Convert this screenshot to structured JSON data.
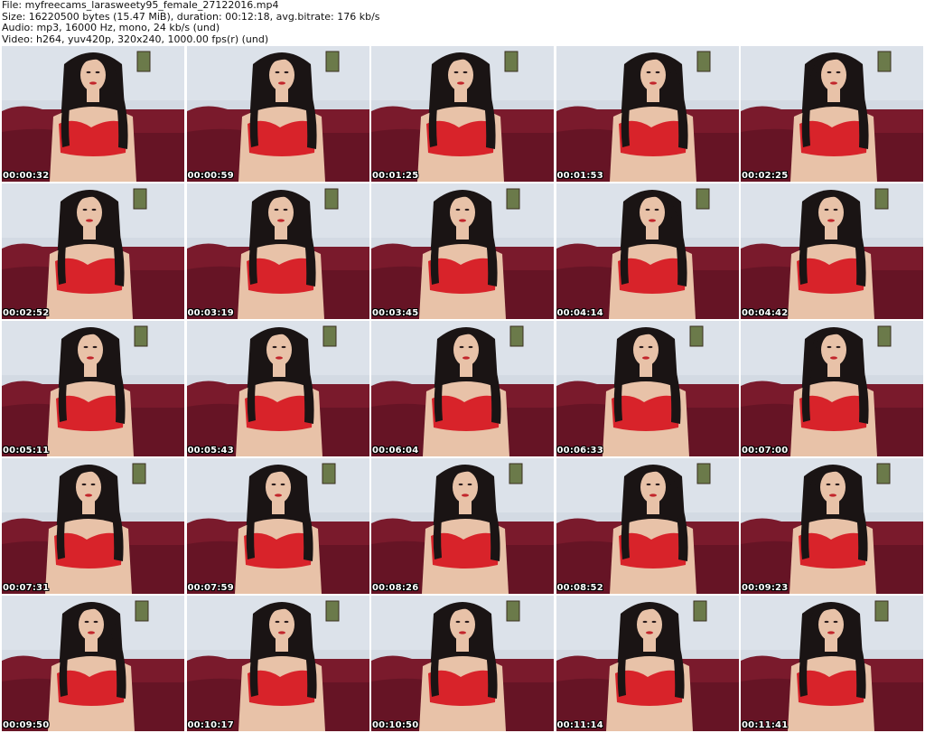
{
  "header": {
    "file_line": "File: myfreecams_larasweety95_female_27122016.mp4",
    "size_line": "Size: 16220500 bytes (15.47 MiB), duration: 00:12:18, avg.bitrate: 176 kb/s",
    "audio_line": "Audio: mp3, 16000 Hz, mono, 24 kb/s (und)",
    "video_line": "Video: h264, yuv420p, 320x240, 1000.00 fps(r) (und)"
  },
  "thumbnails": [
    {
      "timestamp": "00:00:32"
    },
    {
      "timestamp": "00:00:59"
    },
    {
      "timestamp": "00:01:25"
    },
    {
      "timestamp": "00:01:53"
    },
    {
      "timestamp": "00:02:25"
    },
    {
      "timestamp": "00:02:52"
    },
    {
      "timestamp": "00:03:19"
    },
    {
      "timestamp": "00:03:45"
    },
    {
      "timestamp": "00:04:14"
    },
    {
      "timestamp": "00:04:42"
    },
    {
      "timestamp": "00:05:11"
    },
    {
      "timestamp": "00:05:43"
    },
    {
      "timestamp": "00:06:04"
    },
    {
      "timestamp": "00:06:33"
    },
    {
      "timestamp": "00:07:00"
    },
    {
      "timestamp": "00:07:31"
    },
    {
      "timestamp": "00:07:59"
    },
    {
      "timestamp": "00:08:26"
    },
    {
      "timestamp": "00:08:52"
    },
    {
      "timestamp": "00:09:23"
    },
    {
      "timestamp": "00:09:50"
    },
    {
      "timestamp": "00:10:17"
    },
    {
      "timestamp": "00:10:50"
    },
    {
      "timestamp": "00:11:14"
    },
    {
      "timestamp": "00:11:41"
    }
  ],
  "colors": {
    "wall": "#d3dae3",
    "sofa": "#7a1a2c",
    "skin": "#e8c2a8",
    "hair": "#1a1414",
    "garment": "#d8232a",
    "text": "#111111",
    "timestamp_text": "#ffffff"
  }
}
